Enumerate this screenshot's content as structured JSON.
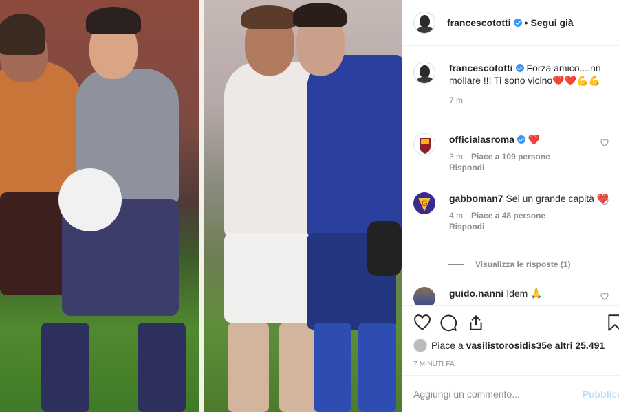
{
  "header": {
    "username": "francescototti",
    "separator": "•",
    "follow_label": "Segui già"
  },
  "caption": {
    "username": "francescototti",
    "text": "Forza amico....nn mollare !!! Ti sono vicino❤️❤️💪💪",
    "time": "7 m"
  },
  "comments": [
    {
      "username": "officialasroma",
      "verified": true,
      "text": "❤️",
      "time": "3 m",
      "likes": "Piace a 109 persone",
      "reply": "Rispondi"
    },
    {
      "username": "gabboman7",
      "verified": false,
      "text": "Sei un grande capità ❤️",
      "time": "4 m",
      "likes": "Piace a 48 persone",
      "reply": "Rispondi"
    },
    {
      "username": "guido.nanni",
      "verified": false,
      "text": "Idem 🙏"
    }
  ],
  "view_replies": "Visualizza le risposte (1)",
  "likes_summary": {
    "prefix": "Piace a ",
    "user": "vasilistorosidis35",
    "middle": " e ",
    "rest": "altri 25.491"
  },
  "timestamp": "7 MINUTI FA",
  "comment_input": {
    "placeholder": "Aggiungi un commento...",
    "post_label": "Pubblica"
  },
  "colors": {
    "verified": "#3897f0",
    "heart": "#ed4956",
    "link_disabled": "#b2dffc",
    "muted": "#8e8e8e"
  },
  "icons": [
    "heart-icon",
    "comment-icon",
    "share-icon",
    "bookmark-icon"
  ]
}
